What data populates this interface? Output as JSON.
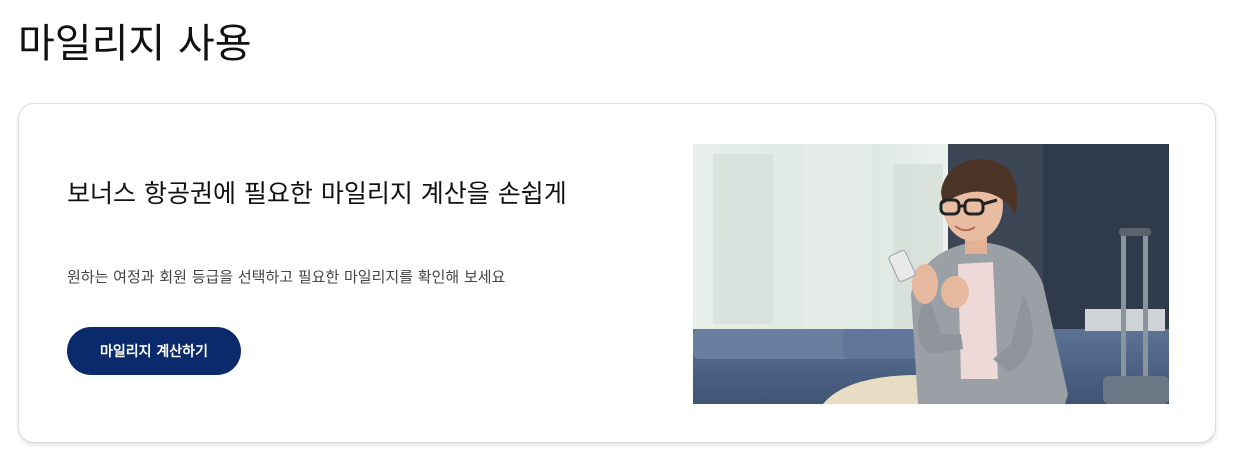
{
  "page": {
    "title": "마일리지 사용"
  },
  "card": {
    "heading": "보너스 항공권에 필요한 마일리지 계산을 손쉽게",
    "subtext": "원하는 여정과 회원 등급을 선택하고 필요한 마일리지를 확인해 보세요",
    "cta_label": "마일리지 계산하기"
  },
  "colors": {
    "cta_bg": "#0a2a6b",
    "cta_text": "#ffffff"
  }
}
